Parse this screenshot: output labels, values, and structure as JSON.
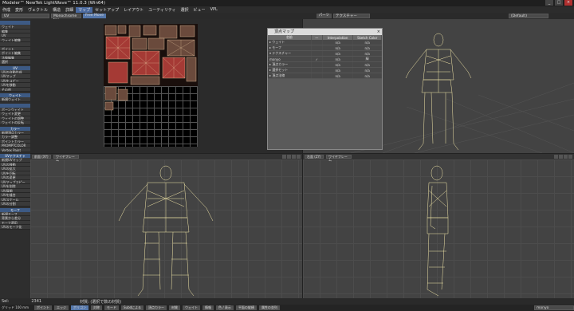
{
  "window": {
    "title": "Modeler™ NewTek LightWave™ 11.0.3 (Win64)",
    "min": "_",
    "max": "□",
    "close": "×"
  },
  "menubar": {
    "items": [
      "作成",
      "変形",
      "ヴェクトル",
      "構造",
      "詳細",
      "マップ",
      "セットアップ",
      "レイアウト",
      "ユーティリティ",
      "選択",
      "ビュー",
      "VPL"
    ],
    "active_index": 5
  },
  "toolbar": {
    "uv_select": "UV",
    "map_select": "Monochrome tex",
    "free_move": "Free Move",
    "parts": "パーツ",
    "texture": "テクスチャー",
    "default": "(Default)"
  },
  "sidebar": {
    "sections": [
      {
        "head": "",
        "items": [
          "ウェイト",
          "編集",
          "UV",
          "ウェイト編集",
          "",
          "ポイント",
          "ポイント編集",
          "法線編集",
          "選択"
        ]
      },
      {
        "head": "UV",
        "items": [
          "UVの自動作成",
          "UVマップ",
          "UVをコピー",
          "UVを移動",
          "その他"
        ]
      },
      {
        "head": "ウェイト",
        "items": [
          "新規ウェイト"
        ]
      },
      {
        "head": "",
        "items": [
          "ボーンウェイト",
          "ウェイト変更",
          "ウェイトの調整",
          "ウェイトの反転"
        ]
      },
      {
        "head": "カラー",
        "items": [
          "新規頂点カラー",
          "カラー調整",
          "ポイントカラー",
          "PROMPTCOLOR",
          "Vertex Paint"
        ]
      },
      {
        "head": "UVテクスチャ",
        "items": [
          "新規UVマップ",
          "UVの移動",
          "UVの拡大",
          "UVを回転",
          "UVの変更",
          "UVマップコピー",
          "UVを削除",
          "UV展開",
          "UVを縫合",
          "UVスケール",
          "UVの分割"
        ]
      },
      {
        "head": "モーフ",
        "items": [
          "新規モーフ",
          "背景から差分",
          "モーフ適用",
          "UVのモーフ化"
        ]
      }
    ]
  },
  "viewports": {
    "top_left": {
      "mode": "UV テクスチャ"
    },
    "bottom_left": {
      "view": "前面 (XY)",
      "shading": "ワイヤフレーム"
    },
    "bottom_right": {
      "view": "右面 (ZY)",
      "shading": "ワイヤフレーム"
    }
  },
  "vertex_map_panel": {
    "title": "頂点マップ",
    "columns": [
      "名前",
      "—",
      "Interpolation",
      "Sketch Color"
    ],
    "rows": [
      {
        "name": "▸ ウェイト",
        "check": "",
        "interp": "n/a",
        "sketch": "n/a"
      },
      {
        "name": "▸ モーフ",
        "check": "",
        "interp": "n/a",
        "sketch": "n/a"
      },
      {
        "name": "▾ テクスチャー",
        "check": "",
        "interp": "n/a",
        "sketch": "n/a"
      },
      {
        "name": "    monyo",
        "check": "✓",
        "interp": "n/a",
        "sketch": "緑"
      },
      {
        "name": "▸ 頂点カラー",
        "check": "",
        "interp": "n/a",
        "sketch": "n/a"
      },
      {
        "name": "▸ 選択セット",
        "check": "",
        "interp": "n/a",
        "sketch": "n/a"
      },
      {
        "name": "▸ 頂点法線",
        "check": "",
        "interp": "n/a",
        "sketch": "n/a"
      }
    ]
  },
  "statusbar": {
    "label": "Sel:",
    "count": "2341",
    "info": "材質: (選択で数の材質)"
  },
  "bottombar": {
    "grid": "グリッド 100 mm",
    "items": [
      "ポイント",
      "エッジ",
      "ポリゴン",
      "対称",
      "モード",
      "Subdによる",
      "頂点カラー",
      "材質",
      "ウェイト",
      "情報",
      "色 / 表示",
      "平面の縦横",
      "属性の並列"
    ],
    "active_index": 2,
    "search": "monyo"
  },
  "colors": {
    "wire": "#f2e6a8",
    "accent": "#4a6aa0",
    "uv_red": "#b03a38"
  }
}
